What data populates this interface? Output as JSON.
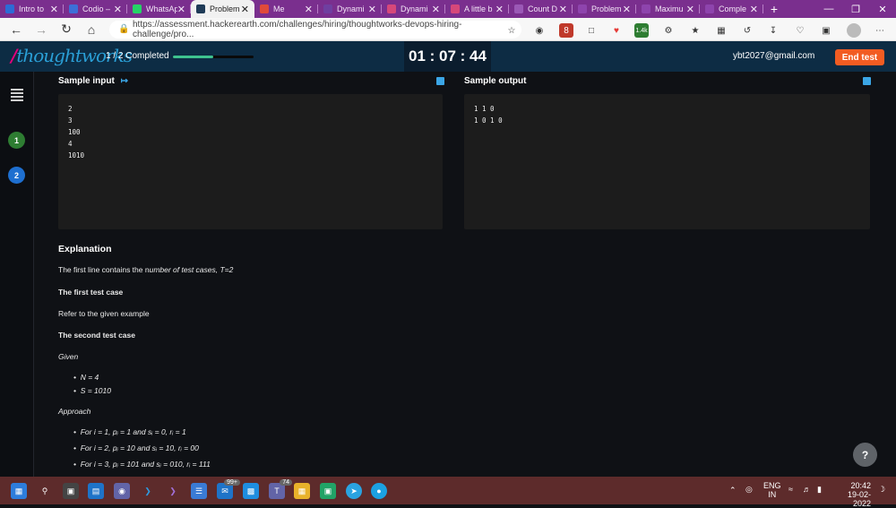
{
  "browser": {
    "tabs": [
      {
        "title": "Intro to",
        "color": "#2d6bd6"
      },
      {
        "title": "Codio –",
        "color": "#3d6fd8"
      },
      {
        "title": "WhatsAp",
        "color": "#25d366"
      },
      {
        "title": "Problem",
        "color": "#1f3b57",
        "active": true
      },
      {
        "title": "Me",
        "color": "#e04a3a"
      },
      {
        "title": "Dynami",
        "color": "#6f3fa0"
      },
      {
        "title": "Dynami",
        "color": "#d6487a"
      },
      {
        "title": "A little b",
        "color": "#d6487a"
      },
      {
        "title": "Count D",
        "color": "#9b59b6"
      },
      {
        "title": "Problem",
        "color": "#8e44ad"
      },
      {
        "title": "Maximu",
        "color": "#8e44ad"
      },
      {
        "title": "Comple",
        "color": "#8e44ad"
      }
    ],
    "url": "https://assessment.hackerearth.com/challenges/hiring/thoughtworks-devops-hiring-challenge/pro...",
    "ext_badges": {
      "ublock": "8",
      "ext2": "1.4k"
    }
  },
  "header": {
    "logo": "thoughtworks",
    "progress_text": "1 / 2 Completed",
    "progress_fraction": 0.5,
    "timer": "01 : 07 : 44",
    "email": "ybt2027@gmail.com",
    "end_test": "End test"
  },
  "nav": {
    "questions": [
      {
        "label": "1",
        "color": "#2e7d32"
      },
      {
        "label": "2",
        "color": "#1e6fd0"
      }
    ]
  },
  "sample_input": {
    "title": "Sample input",
    "lines": [
      "2",
      "3",
      "100",
      "4",
      "1010"
    ]
  },
  "sample_output": {
    "title": "Sample output",
    "lines": [
      "1 1 0",
      "1 0 1 0"
    ]
  },
  "explanation": {
    "heading": "Explanation",
    "intro_a": "The first line contains the n",
    "intro_b": "umber of test cases, T=2",
    "first_case": "The first test case",
    "first_desc": "Refer to the given example",
    "second_case": "The second test case",
    "given": "Given",
    "given_items": [
      "N = 4",
      "S = 1010"
    ],
    "approach": "Approach",
    "approach_items": [
      "For i = 1, pᵢ = 1 and sᵢ = 0, rᵢ = 1",
      "For i = 2, pᵢ = 10 and sᵢ = 10, rᵢ = 00",
      "For i = 3, pᵢ = 101 and sᵢ = 010, rᵢ = 111"
    ]
  },
  "help": "?",
  "taskbar": {
    "badge_mail": "99+",
    "badge_teams": "74",
    "lang": "ENG",
    "region": "IN",
    "time": "20:42",
    "date": "19-02-2022"
  }
}
